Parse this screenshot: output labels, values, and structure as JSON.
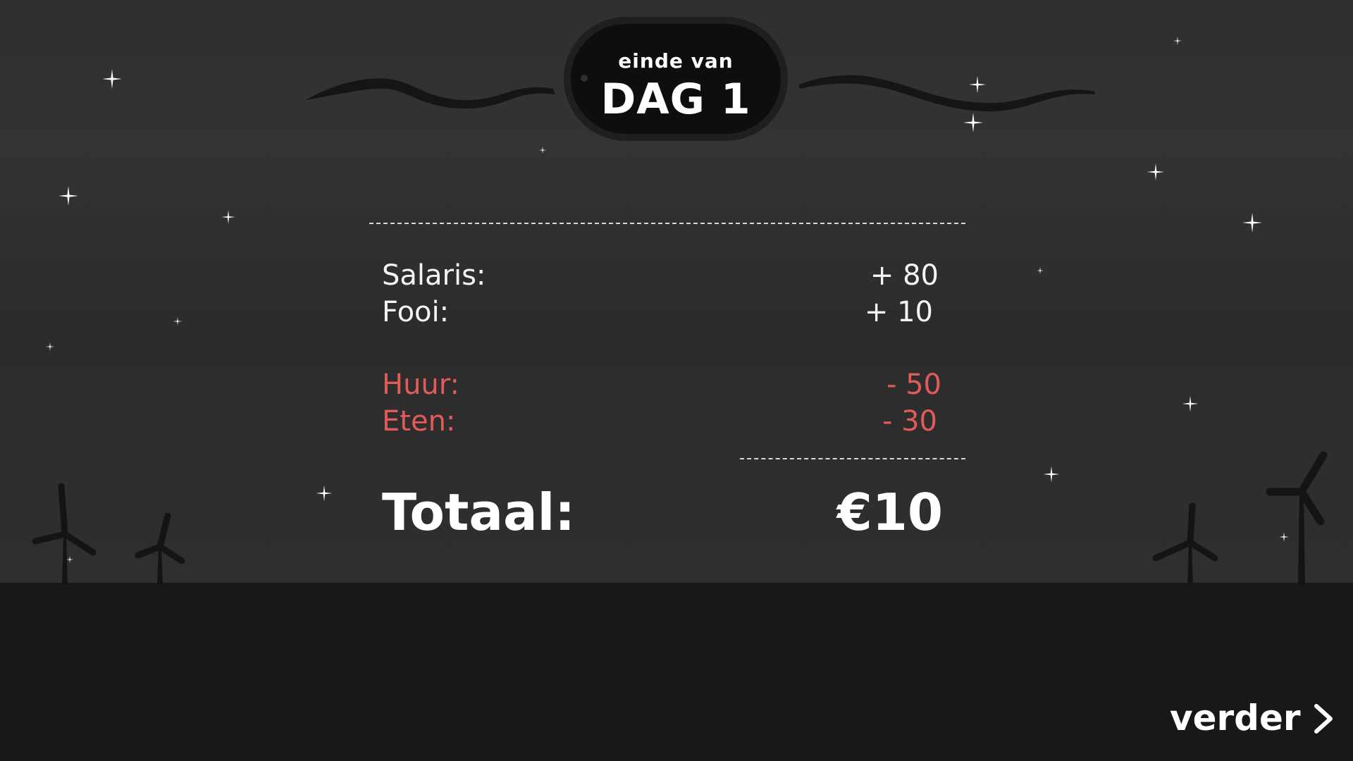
{
  "header": {
    "subtitle": "einde van",
    "title": "DAG 1"
  },
  "receipt": {
    "income": [
      {
        "label": "Salaris:",
        "value": "+ 80"
      },
      {
        "label": "Fooi:",
        "value": "+ 10"
      }
    ],
    "expenses": [
      {
        "label": "Huur:",
        "value": "- 50"
      },
      {
        "label": "Eten:",
        "value": "- 30"
      }
    ],
    "total": {
      "label": "Totaal:",
      "value": "€10"
    }
  },
  "navigation": {
    "next_label": "verder",
    "next_icon": "chevron-right-icon"
  },
  "colors": {
    "sky": "#2f2f2f",
    "ground": "#181818",
    "income_text": "#f4f4f4",
    "expense_text": "#e25a5a",
    "badge": "#0e0e0e"
  }
}
